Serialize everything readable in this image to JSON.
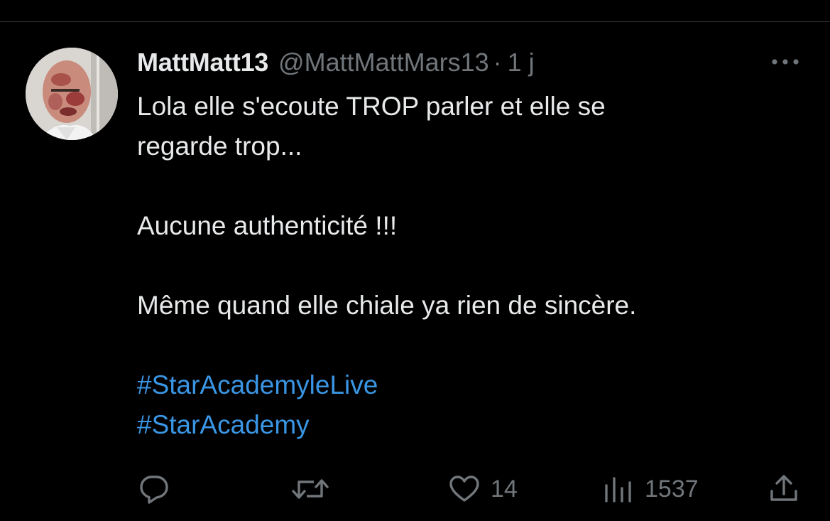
{
  "tweet": {
    "display_name": "MattMatt13",
    "handle": "@MattMattMars13",
    "separator": "·",
    "time": "1 j",
    "lines": [
      "Lola elle s'ecoute TROP parler et elle se",
      "regarde trop...",
      "Aucune authenticité !!!",
      "Même quand elle chiale ya rien de sincère."
    ],
    "hashtags": [
      "#StarAcademyleLive",
      "#StarAcademy"
    ]
  },
  "actions": {
    "reply_icon": "reply-bubble-icon",
    "retweet_icon": "retweet-arrows-icon",
    "like_icon": "heart-icon",
    "like_count": "14",
    "views_icon": "bar-chart-icon",
    "views_count": "1537",
    "share_icon": "share-upload-icon"
  },
  "colors": {
    "background": "#000000",
    "text": "#e7e9ea",
    "muted": "#71767b",
    "link": "#3a96e4",
    "divider": "#2f3336"
  }
}
